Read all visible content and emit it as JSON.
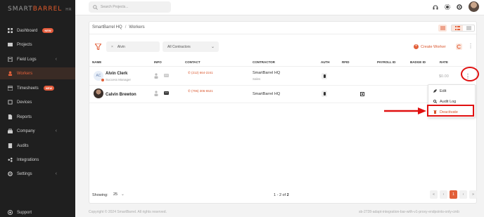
{
  "app": {
    "logo_part1": "SMART",
    "logo_part2": "BARREL",
    "logo_tag": "HR"
  },
  "sidebar": {
    "items": [
      {
        "label": "Dashboard",
        "badge": "NEW",
        "icon": "dashboard-icon"
      },
      {
        "label": "Projects",
        "icon": "projects-icon"
      },
      {
        "label": "Field Logs",
        "chevron": "‹",
        "icon": "field-logs-icon"
      },
      {
        "label": "Workers",
        "icon": "workers-icon",
        "active": true
      },
      {
        "label": "Timesheets",
        "badge": "NEW",
        "icon": "timesheets-icon"
      },
      {
        "label": "Devices",
        "icon": "devices-icon"
      },
      {
        "label": "Reports",
        "icon": "reports-icon"
      },
      {
        "label": "Company",
        "chevron": "‹",
        "icon": "company-icon"
      },
      {
        "label": "Audits",
        "icon": "audits-icon"
      },
      {
        "label": "Integrations",
        "icon": "integrations-icon"
      },
      {
        "label": "Settings",
        "chevron": "‹",
        "icon": "settings-icon"
      }
    ],
    "support": "Support"
  },
  "topbar": {
    "search_placeholder": "Search Projects..."
  },
  "breadcrumb": {
    "root": "SmartBarrel HQ",
    "sep": "/",
    "current": "Workers"
  },
  "filters": {
    "name_value": "Alvin",
    "name_clear": "×",
    "contractor_value": "All Contractors",
    "chevron": "⌄"
  },
  "actions": {
    "create_worker": "Create Worker",
    "plus": "+"
  },
  "table": {
    "headers": [
      "NAME",
      "INFO",
      "CONTACT",
      "CONTRACTOR",
      "AUTH",
      "RFID",
      "PAYROLL ID",
      "BADGE ID",
      "RATE"
    ],
    "rows": [
      {
        "initials": "AC",
        "name": "Alvin Clerk",
        "role": "Success Manager",
        "phone": "(212) 664-2241",
        "contractor": "SmartBarrel HQ",
        "contractor_sub": "Sales",
        "rate": "$0.00"
      },
      {
        "name": "Calvin Brewton",
        "role": "",
        "phone": "(706) 306-6521",
        "contractor": "SmartBarrel HQ",
        "contractor_sub": "",
        "rate": ""
      }
    ]
  },
  "row_menu": {
    "items": [
      "Edit",
      "Audit Log",
      "Deactivate"
    ],
    "kebab": "⋮"
  },
  "pagination": {
    "showing_label": "Showing:",
    "page_size": "25",
    "chevron": "⌄",
    "range_prefix": "1 - 2 of",
    "range_total": "2",
    "pages": [
      "«",
      "‹",
      "1",
      "›",
      "»"
    ],
    "current_page": "1"
  },
  "footer": {
    "copyright": "Copyright © 2024 SmartBarrel. All rights reserved.",
    "build": "sb-2728-adapt-integration-bar-with-v1-proxy-endpoints-only-cmb"
  },
  "colors": {
    "accent": "#e2603a",
    "sidebar_bg": "#1f1f1f",
    "annotation": "#e01010"
  }
}
